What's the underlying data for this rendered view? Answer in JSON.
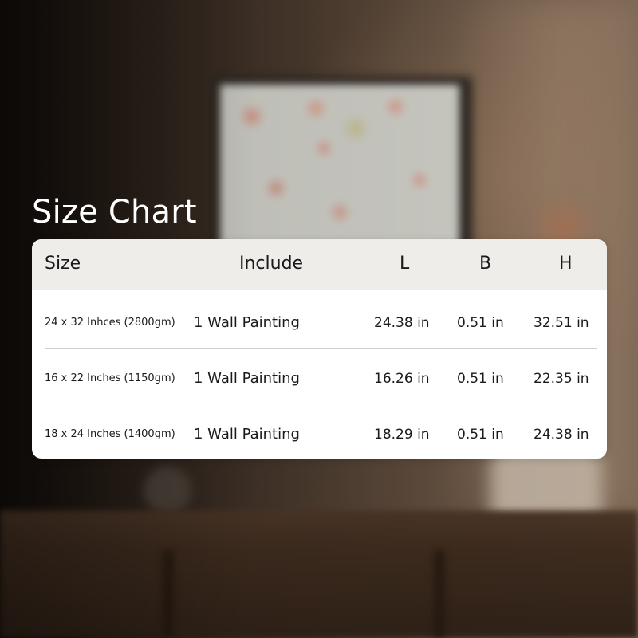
{
  "title": "Size Chart",
  "colors": {
    "card_background": "#ffffff",
    "header_background": "#eeede9",
    "text": "#1a1a1a",
    "title_text": "#ffffff"
  },
  "table": {
    "headers": [
      "Size",
      "Include",
      "L",
      "B",
      "H"
    ],
    "rows": [
      {
        "size": "24 x 32 Inhces (2800gm)",
        "include": "1 Wall Painting",
        "l": "24.38 in",
        "b": "0.51 in",
        "h": "32.51 in"
      },
      {
        "size": "16 x 22 Inches (1150gm)",
        "include": "1 Wall Painting",
        "l": "16.26 in",
        "b": "0.51 in",
        "h": "22.35 in"
      },
      {
        "size": "18 x 24 Inches (1400gm)",
        "include": "1 Wall Painting",
        "l": "18.29 in",
        "b": "0.51 in",
        "h": "24.38 in"
      }
    ]
  }
}
